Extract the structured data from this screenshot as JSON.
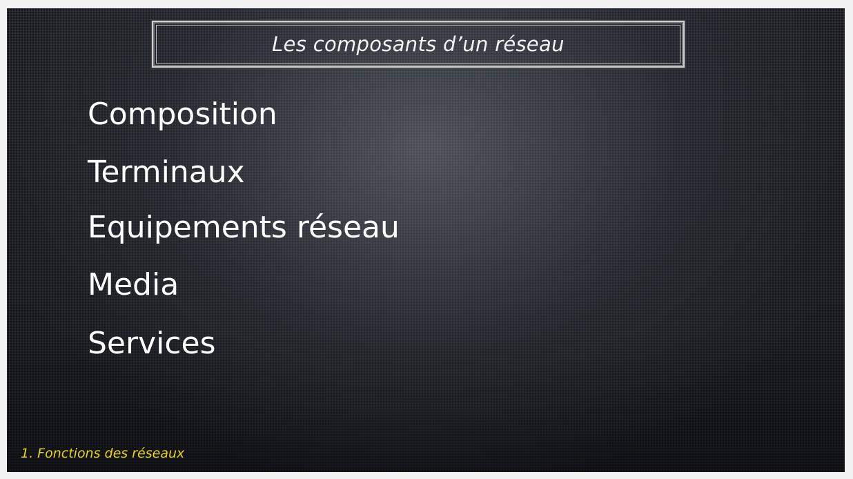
{
  "slide": {
    "title": "Les composants d’un réseau",
    "items": [
      "Composition",
      "Terminaux",
      "Equipements réseau",
      "Media",
      "Services"
    ],
    "footer": "1. Fonctions des réseaux",
    "colors": {
      "background": "#2a2d33",
      "text": "#ffffff",
      "footer": "#e8d60a",
      "title_border": "#d0d0d0"
    }
  }
}
